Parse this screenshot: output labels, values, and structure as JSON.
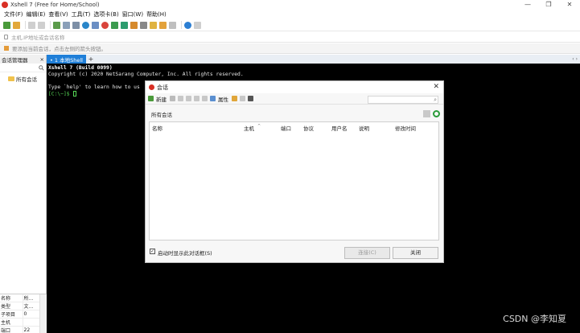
{
  "window": {
    "title": "Xshell 7 (Free for Home/School)",
    "controls": [
      "—",
      "❐",
      "✕"
    ]
  },
  "menu": [
    "文件(F)",
    "编辑(E)",
    "查看(V)",
    "工具(T)",
    "选项卡(B)",
    "窗口(W)",
    "帮助(H)"
  ],
  "address": {
    "placeholder": "主机,IP地址或会话名称"
  },
  "hint": {
    "text": "要添加当前会话，点击左侧的箭头按钮。"
  },
  "tabs": {
    "session_manager": "会话管理器",
    "pin": "ᵖ",
    "close": "×",
    "active_tab": "• 1 本地Shell",
    "add": "+",
    "scroll": "‹ ›"
  },
  "sidebar": {
    "root_item": "所有会话"
  },
  "properties": {
    "rows": [
      {
        "key": "名称",
        "value": "所..."
      },
      {
        "key": "类型",
        "value": "文..."
      },
      {
        "key": "子项目",
        "value": "0"
      },
      {
        "key": "主机",
        "value": ""
      },
      {
        "key": "端口",
        "value": "22"
      }
    ]
  },
  "terminal": {
    "line1": "Xshell 7 (Build 0099)",
    "line2": "Copyright (c) 2020 NetSarang Computer, Inc. All rights reserved.",
    "line3": "Type `help' to learn how to us",
    "prompt": "[C:\\~]$ "
  },
  "dialog": {
    "title": "会话",
    "close": "✕",
    "new_label": "新建",
    "properties_label": "属性",
    "path": "所有会话",
    "columns": [
      "名称",
      "主机",
      "端口",
      "协议",
      "用户名",
      "说明",
      "修改时间"
    ],
    "sort_indicator": "^",
    "show_on_startup": "启动时显示此对话框(S)",
    "checkbox": "✓",
    "connect_button": "连接(C)",
    "close_button": "关闭"
  },
  "watermark": "CSDN @李知夏",
  "colors": {
    "accent_tab": "#1f7fd8",
    "terminal_bg": "#000000",
    "prompt": "#57d957",
    "logo": "#d93025"
  }
}
